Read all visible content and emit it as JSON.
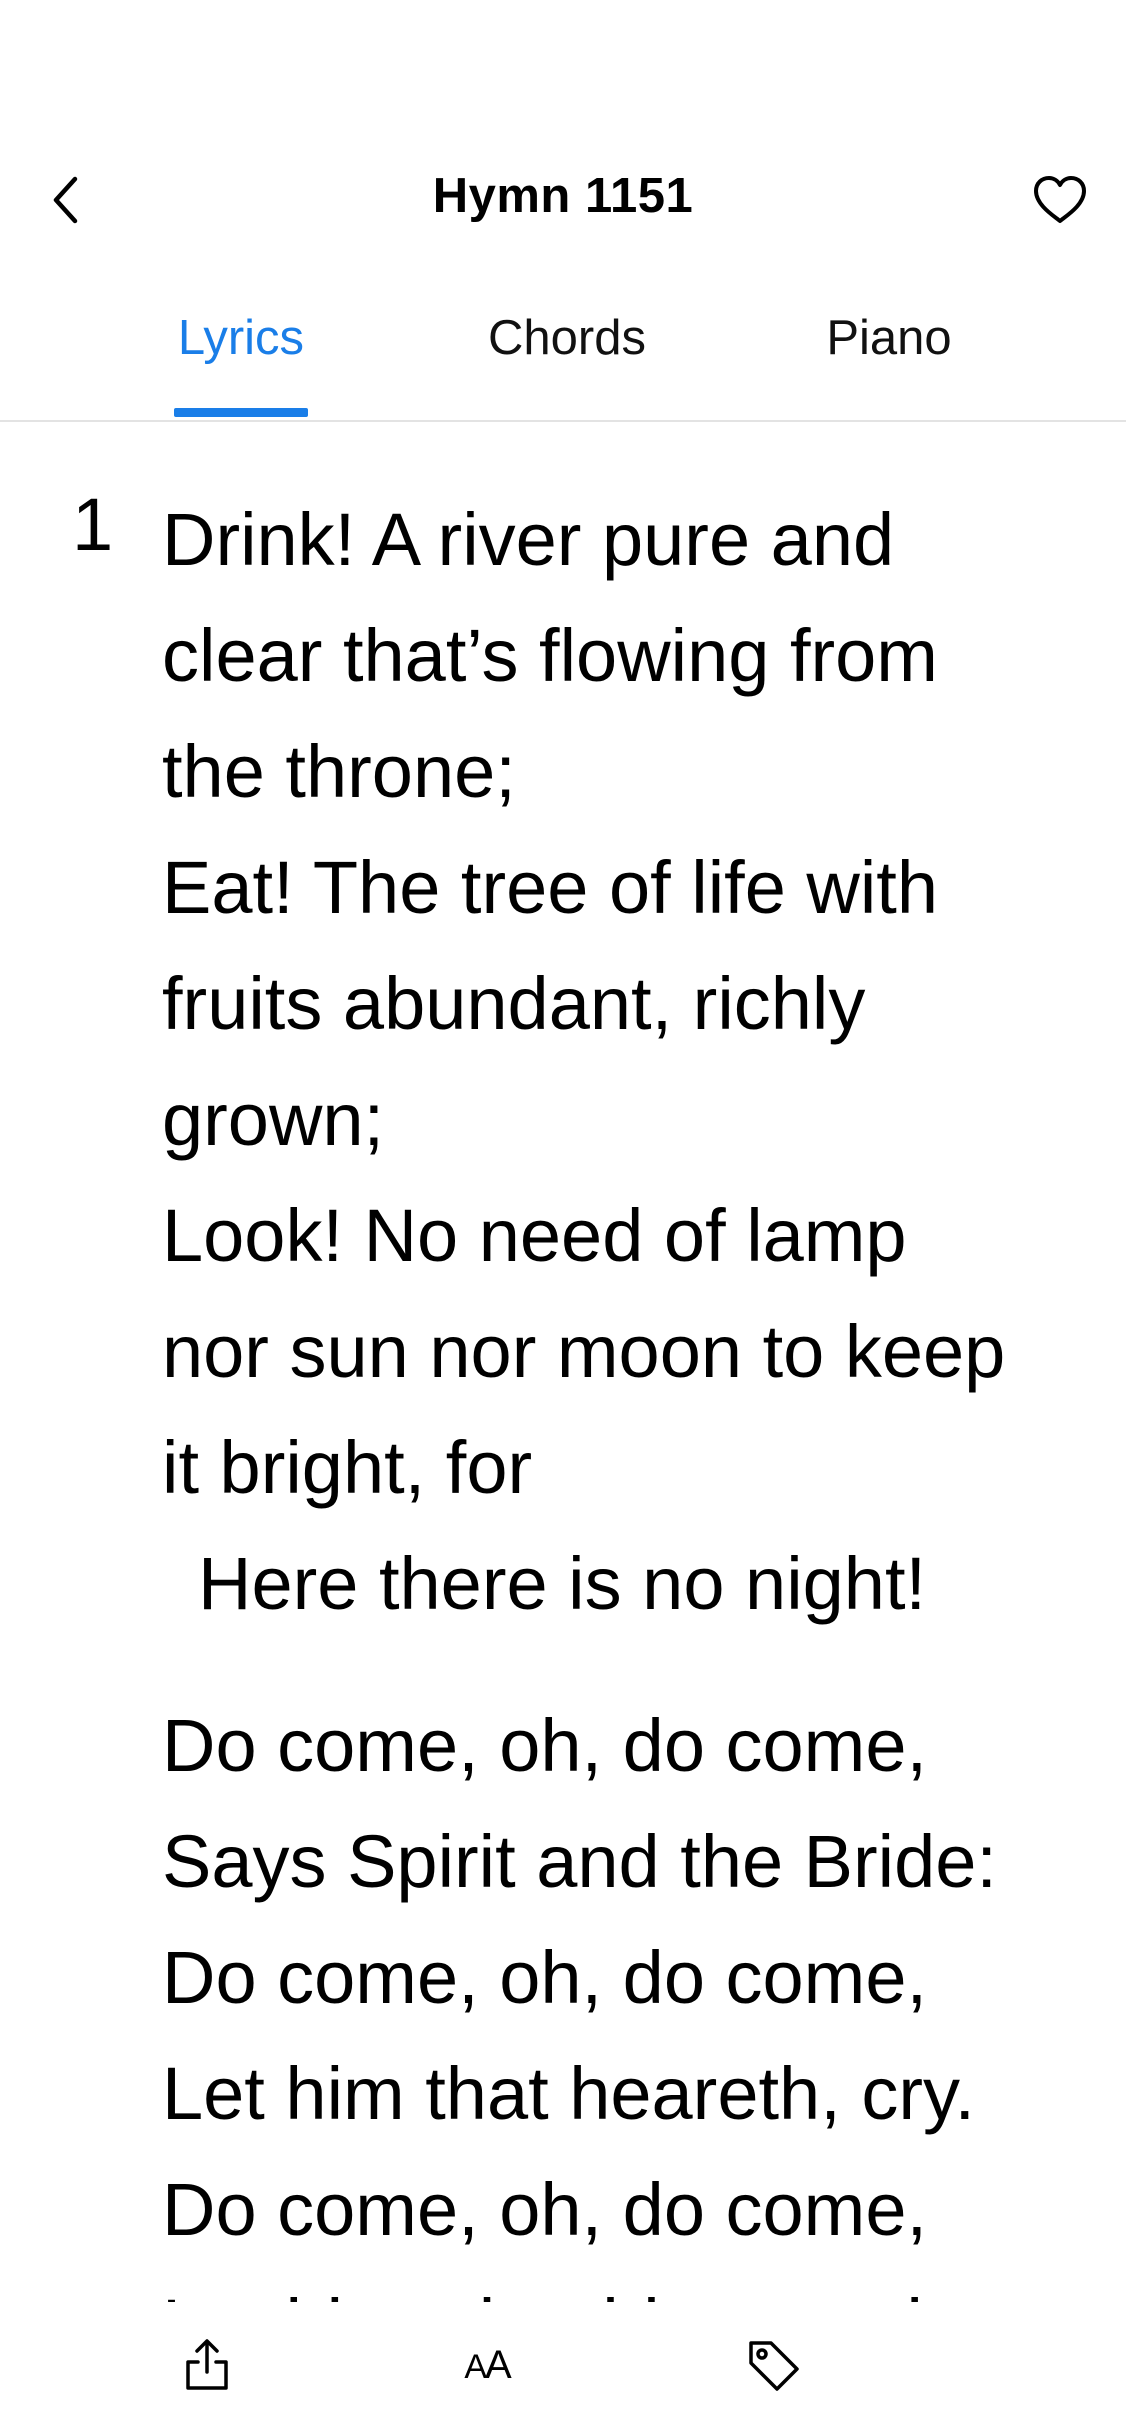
{
  "header": {
    "title": "Hymn 1151",
    "back_icon": "chevron-left-icon",
    "favorite_icon": "heart-outline-icon"
  },
  "tabs": [
    {
      "label": "Lyrics",
      "active": true
    },
    {
      "label": "Chords",
      "active": false
    },
    {
      "label": "Piano",
      "active": false
    }
  ],
  "colors": {
    "accent": "#1a7ee8",
    "text": "#000000",
    "divider": "#e3e3e3"
  },
  "lyrics": {
    "verse_number": "1",
    "verse": [
      "Drink! A river pure and",
      "clear that’s flowing from",
      "the throne;",
      "Eat! The tree of life with",
      "fruits abundant, richly",
      "grown;",
      "Look! No need of lamp",
      "nor sun nor moon to keep",
      "it bright, for",
      "Here there is no night!"
    ],
    "chorus": [
      "Do come, oh, do come,",
      "Says Spirit and the Bride:",
      "Do come, oh, do come,",
      "Let him that heareth, cry.",
      "Do come, oh, do come,",
      "Let him who thirsts and"
    ]
  },
  "toolbar": {
    "share_icon": "share-icon",
    "font_size_label": {
      "small": "A",
      "large": "A"
    },
    "tag_icon": "tag-icon"
  }
}
